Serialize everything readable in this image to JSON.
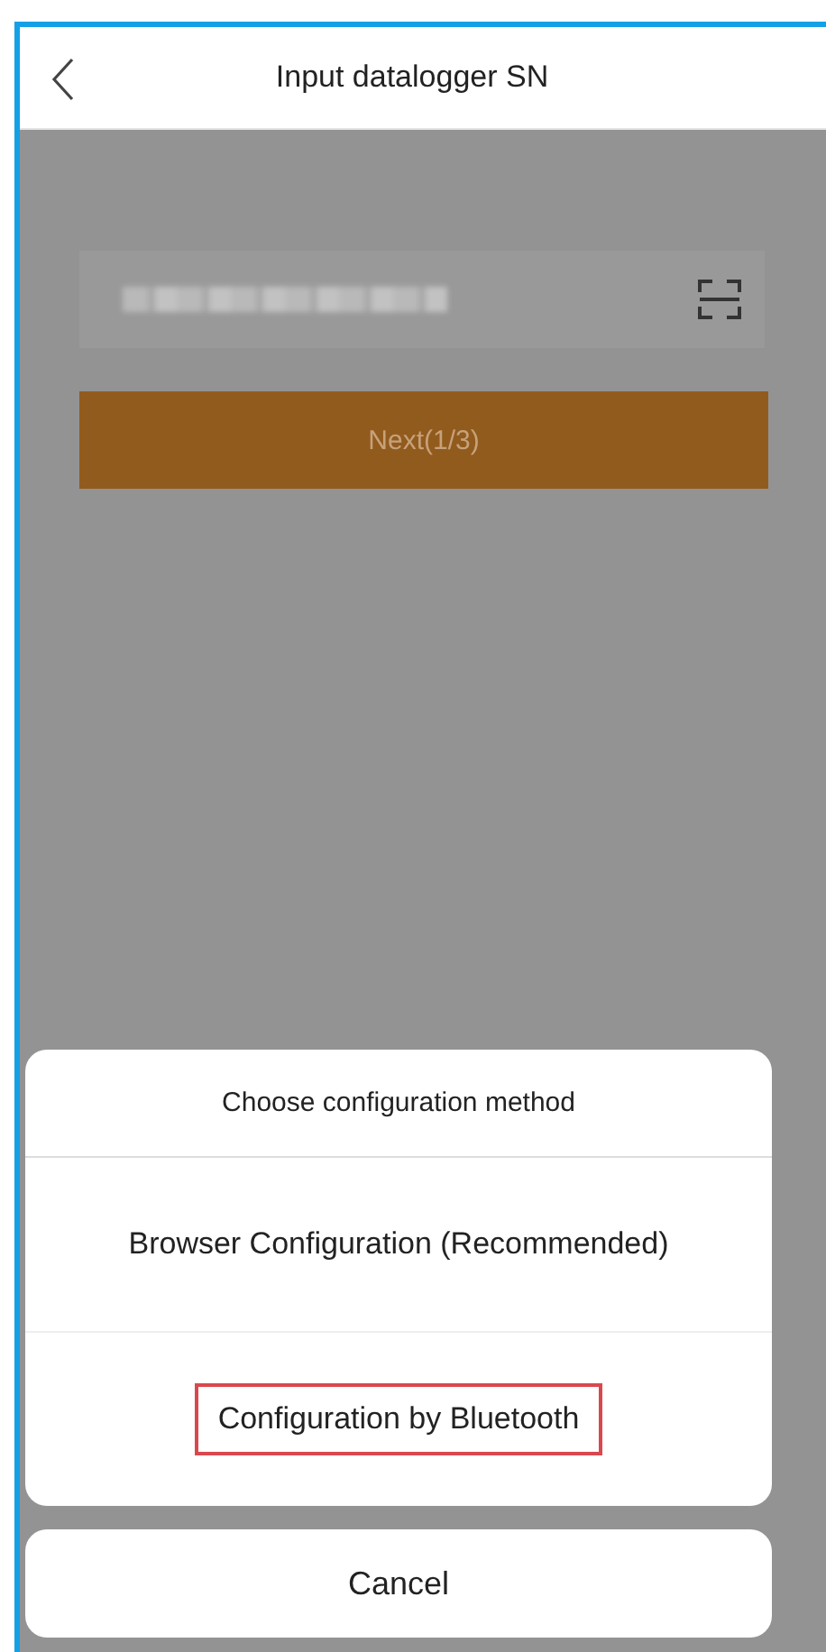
{
  "header": {
    "title": "Input datalogger SN"
  },
  "sn_field": {
    "redacted": true
  },
  "next_button": {
    "label": "Next(1/3)",
    "disabled": true
  },
  "action_sheet": {
    "title": "Choose configuration method",
    "options": [
      {
        "label": "Browser Configuration (Recommended)",
        "highlighted": false
      },
      {
        "label": "Configuration by Bluetooth",
        "highlighted": true
      }
    ],
    "cancel": "Cancel"
  }
}
